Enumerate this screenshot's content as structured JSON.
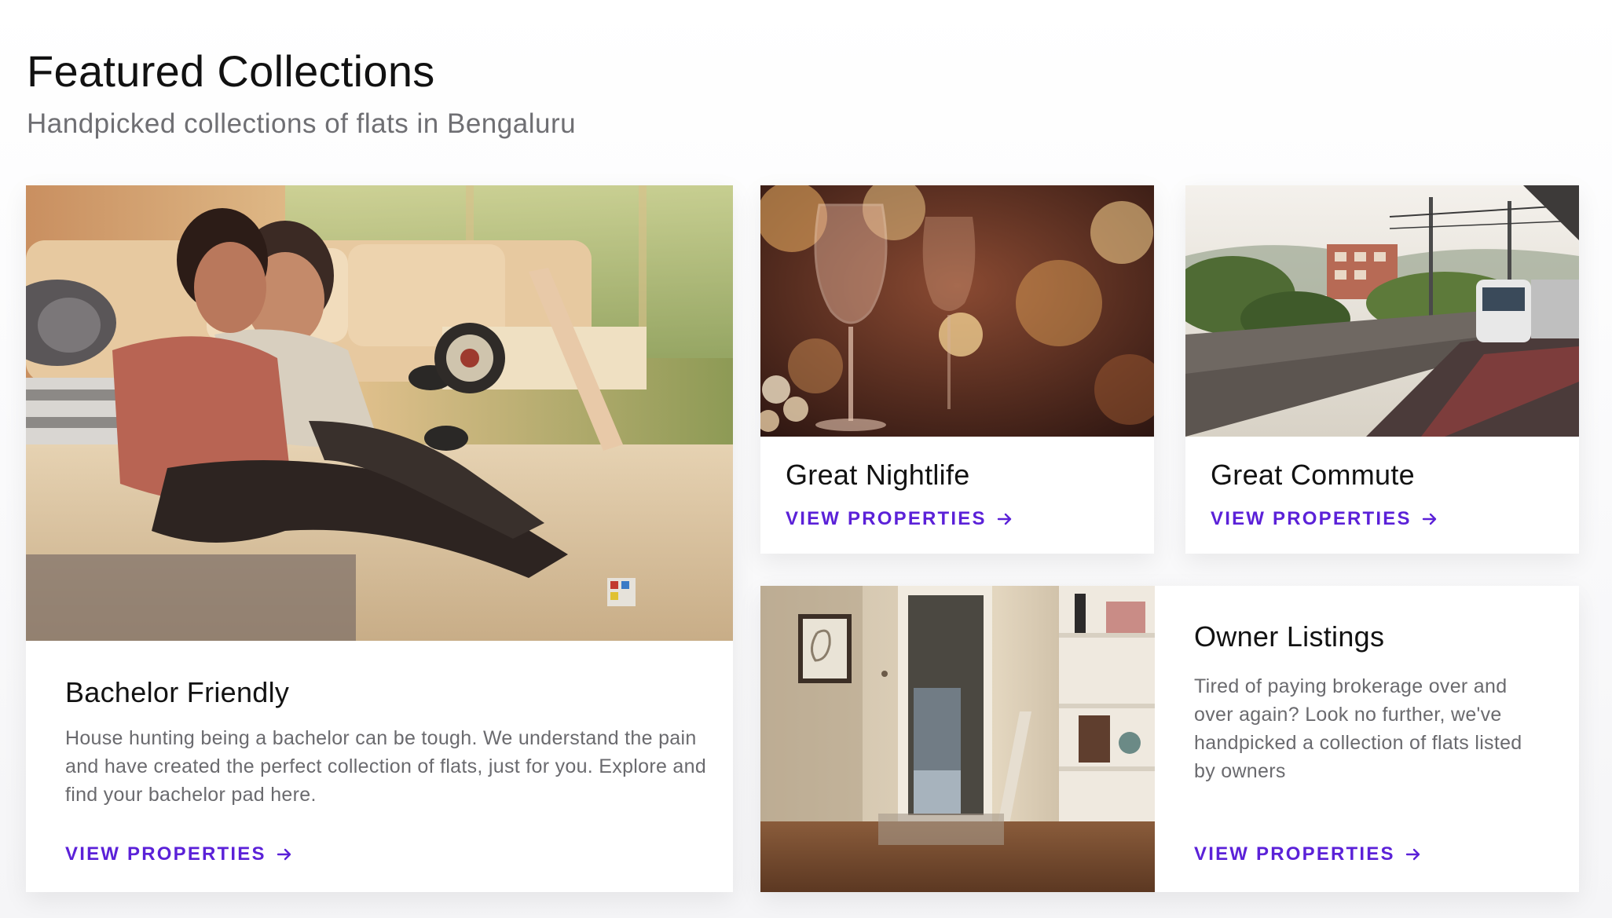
{
  "section": {
    "title": "Featured Collections",
    "subtitle": "Handpicked collections of flats in Bengaluru"
  },
  "cards": {
    "bachelor": {
      "title": "Bachelor Friendly",
      "description": "House hunting being a bachelor can be tough. We understand the pain and have created the perfect collection of flats, just for you. Explore and find your bachelor pad here.",
      "link_label": "VIEW PROPERTIES"
    },
    "nightlife": {
      "title": "Great Nightlife",
      "link_label": "VIEW PROPERTIES"
    },
    "commute": {
      "title": "Great Commute",
      "link_label": "VIEW PROPERTIES"
    },
    "owner": {
      "title": "Owner Listings",
      "description": "Tired of paying brokerage over and over again? Look no further, we've handpicked a collection of flats listed by owners",
      "link_label": "VIEW PROPERTIES"
    }
  },
  "colors": {
    "accent": "#5b21d8",
    "title_text": "#111111",
    "muted_text": "#6f6f73"
  },
  "icons": {
    "link_arrow": "arrow-right-icon"
  }
}
